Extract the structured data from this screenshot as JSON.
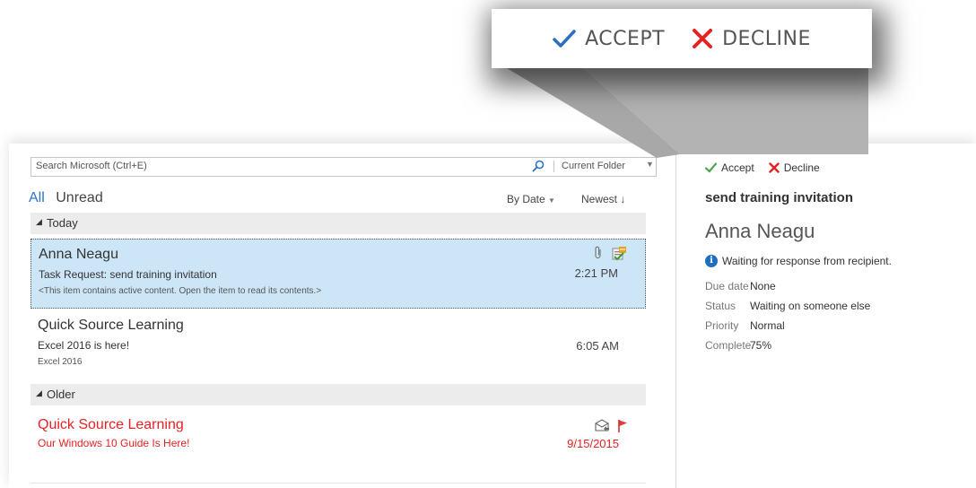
{
  "callout": {
    "accept_label": "ACCEPT",
    "decline_label": "DECLINE"
  },
  "search": {
    "placeholder": "Search Microsoft (Ctrl+E)",
    "scope": "Current Folder"
  },
  "filters": {
    "all": "All",
    "unread": "Unread",
    "sort_by": "By Date",
    "order": "Newest"
  },
  "groups": {
    "today": "Today",
    "older": "Older"
  },
  "messages": [
    {
      "sender": "Anna Neagu",
      "subject": "Task Request: send training invitation",
      "preview": "<This item contains active content. Open the item to read its contents.>",
      "time": "2:21 PM"
    },
    {
      "sender": "Quick Source Learning",
      "subject": "Excel 2016 is here!",
      "preview": "Excel 2016",
      "time": "6:05 AM"
    },
    {
      "sender": "Quick Source Learning",
      "subject": "Our Windows 10 Guide Is Here!",
      "preview": "",
      "time": "9/15/2015"
    }
  ],
  "reading": {
    "accept_label": "Accept",
    "decline_label": "Decline",
    "subject": "send training invitation",
    "sender": "Anna Neagu",
    "info": "Waiting for response from recipient.",
    "fields": [
      {
        "label": "Due date",
        "value": "None"
      },
      {
        "label": "Status",
        "value": "Waiting on someone else"
      },
      {
        "label": "Priority",
        "value": "Normal"
      },
      {
        "label": "Complete",
        "value": "75%"
      }
    ]
  },
  "colors": {
    "accent": "#2a74c5",
    "selected_bg": "#cde6f7",
    "unread_red": "#e52222",
    "accept_blue": "#2b6fc4",
    "accept_green": "#4aa84a",
    "decline_red": "#e52222"
  },
  "icons": [
    "check-icon",
    "x-icon",
    "search-icon",
    "attachment-icon",
    "task-request-icon",
    "reply-icon",
    "flag-icon",
    "info-icon"
  ]
}
